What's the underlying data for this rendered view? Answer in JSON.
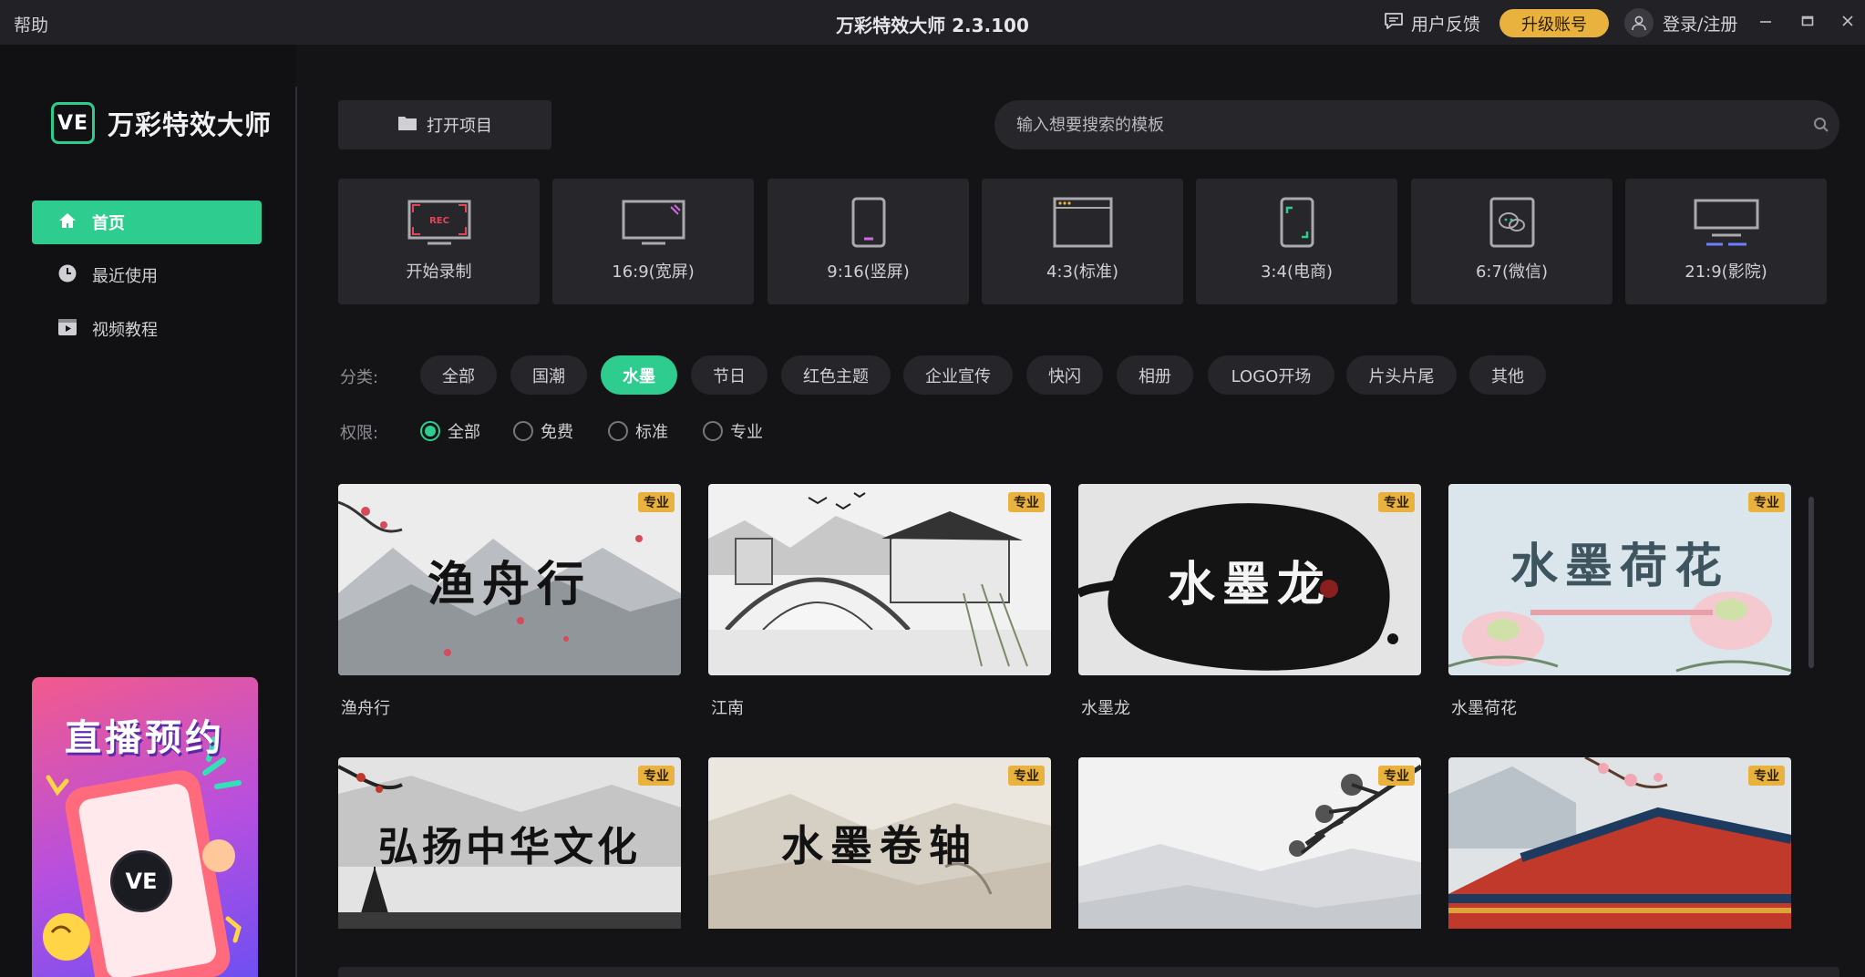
{
  "titlebar": {
    "help": "帮助",
    "title": "万彩特效大师 2.3.100",
    "feedback": "用户反馈",
    "upgrade": "升级账号",
    "login": "登录/注册"
  },
  "sidebar": {
    "logo_mark": "VE",
    "logo_text": "万彩特效大师",
    "items": [
      {
        "label": "首页",
        "icon": "home-icon",
        "active": true
      },
      {
        "label": "最近使用",
        "icon": "clock-icon",
        "active": false
      },
      {
        "label": "视频教程",
        "icon": "video-tutorial-icon",
        "active": false
      }
    ],
    "promo": {
      "title": "直播预约",
      "badge": "VE"
    }
  },
  "toolbar": {
    "open_project": "打开项目",
    "search_placeholder": "输入想要搜索的模板"
  },
  "formats": [
    {
      "label": "开始录制",
      "icon": "record-icon"
    },
    {
      "label": "16:9(宽屏)",
      "icon": "widescreen-icon"
    },
    {
      "label": "9:16(竖屏)",
      "icon": "portrait-icon"
    },
    {
      "label": "4:3(标准)",
      "icon": "standard-icon"
    },
    {
      "label": "3:4(电商)",
      "icon": "ecommerce-icon"
    },
    {
      "label": "6:7(微信)",
      "icon": "wechat-icon"
    },
    {
      "label": "21:9(影院)",
      "icon": "cinema-icon"
    }
  ],
  "filters": {
    "category_label": "分类:",
    "categories": [
      "全部",
      "国潮",
      "水墨",
      "节日",
      "红色主题",
      "企业宣传",
      "快闪",
      "相册",
      "LOGO开场",
      "片头片尾",
      "其他"
    ],
    "active_category": "水墨",
    "permission_label": "权限:",
    "permissions": [
      "全部",
      "免费",
      "标准",
      "专业"
    ],
    "active_permission": "全部"
  },
  "templates": [
    {
      "title": "渔舟行",
      "badge": "专业",
      "art_text": "渔舟行"
    },
    {
      "title": "江南",
      "badge": "专业",
      "art_text": ""
    },
    {
      "title": "水墨龙",
      "badge": "专业",
      "art_text": "水墨龙"
    },
    {
      "title": "水墨荷花",
      "badge": "专业",
      "art_text": "水墨荷花"
    },
    {
      "title": "",
      "badge": "专业",
      "art_text": "弘扬中华文化"
    },
    {
      "title": "",
      "badge": "专业",
      "art_text": "水墨卷轴"
    },
    {
      "title": "",
      "badge": "专业",
      "art_text": ""
    },
    {
      "title": "",
      "badge": "专业",
      "art_text": ""
    }
  ],
  "colors": {
    "accent": "#2ecc8e",
    "upgrade": "#e9b23e",
    "background": "#141416",
    "panel": "#27272b"
  }
}
